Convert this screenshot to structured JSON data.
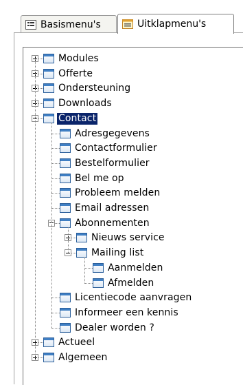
{
  "tabs": [
    {
      "label": "Basismenu's",
      "icon": "list-icon",
      "active": false
    },
    {
      "label": "Uitklapmenu's",
      "icon": "dropdown-menu-icon",
      "active": true
    }
  ],
  "tree": [
    {
      "label": "Modules",
      "level": 0,
      "state": "collapsed"
    },
    {
      "label": "Offerte",
      "level": 0,
      "state": "collapsed"
    },
    {
      "label": "Ondersteuning",
      "level": 0,
      "state": "collapsed"
    },
    {
      "label": "Downloads",
      "level": 0,
      "state": "collapsed"
    },
    {
      "label": "Contact",
      "level": 0,
      "state": "expanded",
      "selected": true
    },
    {
      "label": "Adresgegevens",
      "level": 1,
      "state": "leaf"
    },
    {
      "label": "Contactformulier",
      "level": 1,
      "state": "leaf"
    },
    {
      "label": "Bestelformulier",
      "level": 1,
      "state": "leaf"
    },
    {
      "label": "Bel me op",
      "level": 1,
      "state": "leaf"
    },
    {
      "label": "Probleem melden",
      "level": 1,
      "state": "leaf"
    },
    {
      "label": "Email adressen",
      "level": 1,
      "state": "leaf"
    },
    {
      "label": "Abonnementen",
      "level": 1,
      "state": "expanded"
    },
    {
      "label": "Nieuws service",
      "level": 2,
      "state": "collapsed"
    },
    {
      "label": "Mailing list",
      "level": 2,
      "state": "expanded"
    },
    {
      "label": "Aanmelden",
      "level": 3,
      "state": "leaf"
    },
    {
      "label": "Afmelden",
      "level": 3,
      "state": "leaf"
    },
    {
      "label": "Licentiecode aanvragen",
      "level": 1,
      "state": "leaf"
    },
    {
      "label": "Informeer een kennis",
      "level": 1,
      "state": "leaf"
    },
    {
      "label": "Dealer worden ?",
      "level": 1,
      "state": "leaf"
    },
    {
      "label": "Actueel",
      "level": 0,
      "state": "collapsed"
    },
    {
      "label": "Algemeen",
      "level": 0,
      "state": "collapsed"
    }
  ],
  "colors": {
    "selection": "#0a246a",
    "icon_blue": "#3f7fc4"
  }
}
